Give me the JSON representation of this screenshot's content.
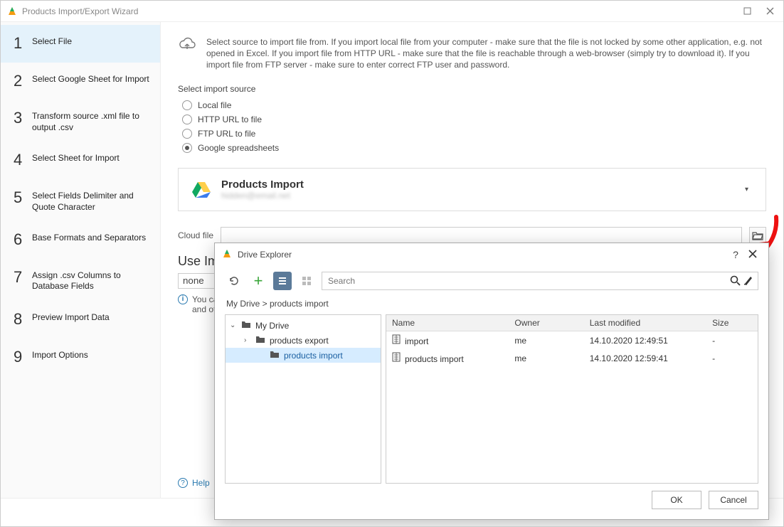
{
  "window": {
    "title": "Products Import/Export Wizard"
  },
  "steps": [
    {
      "num": "1",
      "label": "Select File",
      "active": true
    },
    {
      "num": "2",
      "label": "Select Google Sheet for Import"
    },
    {
      "num": "3",
      "label": "Transform source .xml file to output .csv"
    },
    {
      "num": "4",
      "label": "Select Sheet for Import"
    },
    {
      "num": "5",
      "label": "Select Fields Delimiter and Quote Character"
    },
    {
      "num": "6",
      "label": "Base Formats and Separators"
    },
    {
      "num": "7",
      "label": "Assign .csv Columns to Database Fields"
    },
    {
      "num": "8",
      "label": "Preview Import Data"
    },
    {
      "num": "9",
      "label": "Import Options"
    }
  ],
  "intro": "Select source to import file from. If you import local file from your computer - make sure that the file is not locked by some other application, e.g. not opened in Excel. If you import file from HTTP URL - make sure that the file is reachable through a web-browser (simply try to download it). If you import file from FTP server - make sure to enter correct FTP user and password.",
  "source_label": "Select import source",
  "radios": [
    {
      "label": "Local file"
    },
    {
      "label": "HTTP URL to file"
    },
    {
      "label": "FTP URL to file"
    },
    {
      "label": "Google spreadsheets",
      "selected": true
    }
  ],
  "drive": {
    "name": "Products Import",
    "email": "hidden@email.net"
  },
  "cloud_label": "Cloud file",
  "cloud_value": "",
  "use_header": "Use Im",
  "none_value": "none",
  "hint": "You ca\nand ot",
  "help": "Help",
  "modal": {
    "title": "Drive Explorer",
    "search_placeholder": "Search",
    "breadcrumb": "My Drive  >  products import",
    "tree": {
      "root": "My Drive",
      "children": [
        {
          "name": "products export"
        },
        {
          "name": "products import",
          "selected": true
        }
      ]
    },
    "columns": {
      "name": "Name",
      "owner": "Owner",
      "mod": "Last modified",
      "size": "Size"
    },
    "rows": [
      {
        "name": "import",
        "owner": "me",
        "mod": "14.10.2020 12:49:51",
        "size": "-"
      },
      {
        "name": "products import",
        "owner": "me",
        "mod": "14.10.2020 12:59:41",
        "size": "-"
      }
    ],
    "ok": "OK",
    "cancel": "Cancel"
  }
}
